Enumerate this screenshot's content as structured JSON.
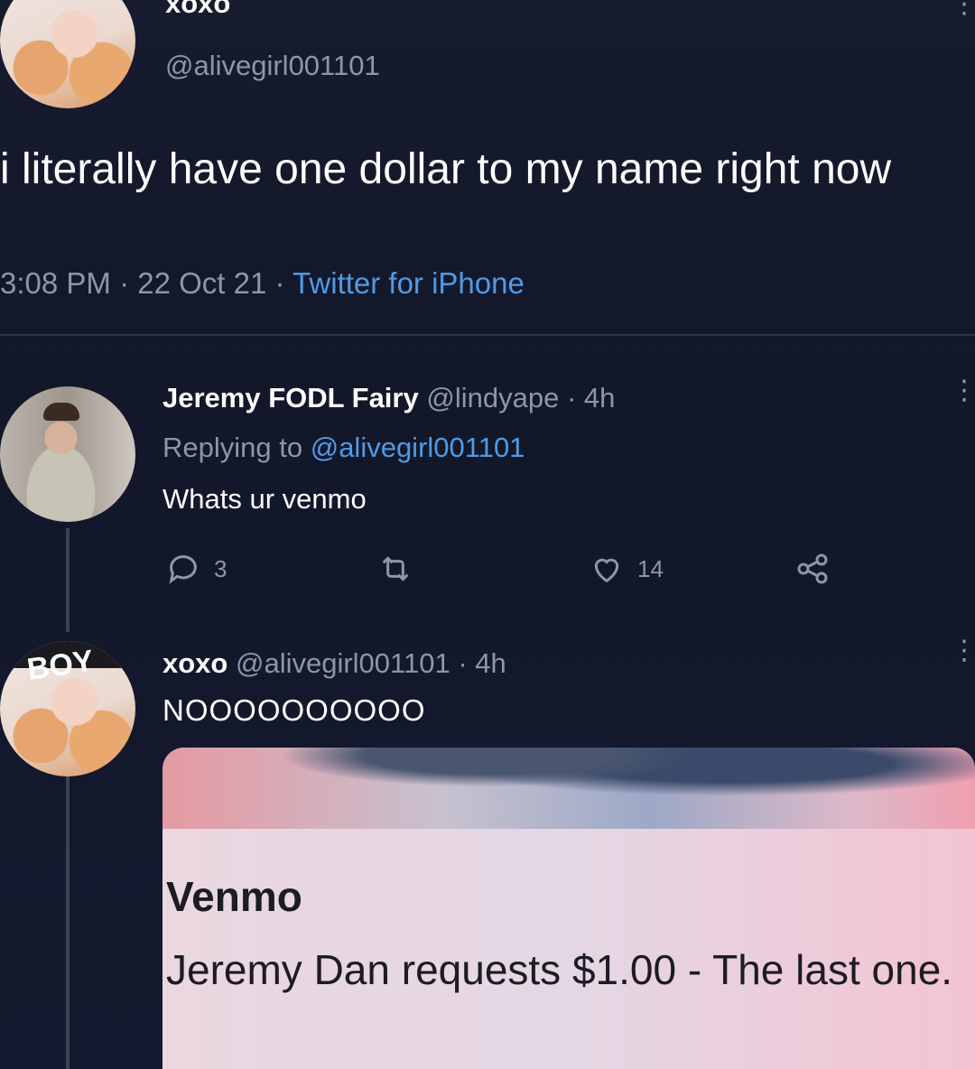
{
  "main_tweet": {
    "display_name": "xoxo",
    "handle": "@alivegirl001101",
    "text": "i literally have one dollar to my name right now",
    "time": "3:08 PM",
    "date": "22 Oct 21",
    "source": "Twitter for iPhone",
    "separator": " · "
  },
  "reply": {
    "display_name": "Jeremy FODL Fairy",
    "handle": "@lindyape",
    "age": "· 4h",
    "replying_prefix": "Replying to ",
    "replying_to": "@alivegirl001101",
    "text": "Whats ur venmo",
    "reply_count": "3",
    "like_count": "14"
  },
  "second_reply": {
    "display_name": "xoxo",
    "handle": "@alivegirl001101",
    "age": "· 4h",
    "text": "NOOOOOOOOOO",
    "avatar_label": "BOY"
  },
  "media": {
    "title": "Venmo",
    "text": "Jeremy Dan requests $1.00 - The last one."
  },
  "icons": {
    "more": "more-vertical-icon",
    "reply": "reply-icon",
    "retweet": "retweet-icon",
    "like": "heart-icon",
    "share": "share-icon"
  },
  "colors": {
    "background": "#15202b",
    "link": "#4f9be6",
    "muted": "#8b98a5"
  }
}
